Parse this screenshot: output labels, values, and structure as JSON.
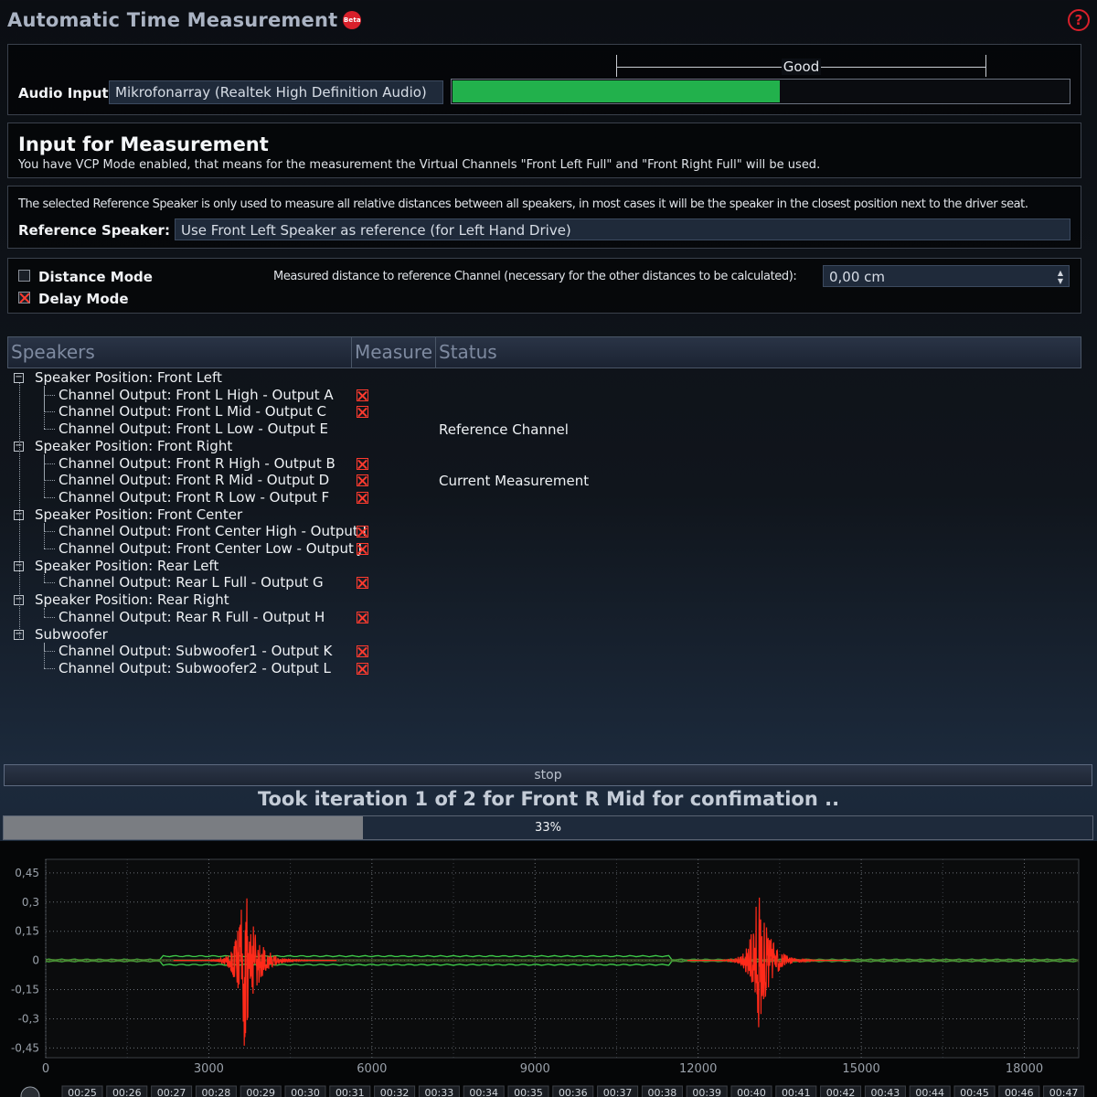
{
  "header": {
    "title": "Automatic Time Measurement",
    "beta_badge": "Beta",
    "help_icon": "?"
  },
  "audio_input": {
    "label": "Audio Input:",
    "device": "Mikrofonarray (Realtek High Definition Audio)",
    "level_label": "Good",
    "level_fraction": 0.53,
    "level_color": "#22b14c"
  },
  "measurement_input": {
    "title": "Input for Measurement",
    "description": "You have VCP Mode enabled, that means for the measurement the Virtual Channels \"Front Left Full\" and \"Front Right Full\" will be used."
  },
  "reference": {
    "note": "The selected Reference Speaker is only used to measure all relative distances between all speakers, in most cases it will be the speaker in the closest position next to the driver seat.",
    "label": "Reference Speaker:",
    "value": "Use Front Left Speaker as reference (for Left Hand Drive)"
  },
  "mode": {
    "distance_mode": {
      "label": "Distance Mode",
      "checked": false
    },
    "delay_mode": {
      "label": "Delay Mode",
      "checked": true
    },
    "distance_label": "Measured distance to reference Channel (necessary for the other distances to be calculated):",
    "distance_value": "0,00 cm"
  },
  "table": {
    "columns": [
      "Speakers",
      "Measure",
      "Status"
    ],
    "rows": [
      {
        "level": 0,
        "text": "Speaker Position: Front Left",
        "measure": false,
        "status": ""
      },
      {
        "level": 1,
        "text": "Channel Output: Front L High - Output A",
        "measure": true,
        "status": ""
      },
      {
        "level": 1,
        "text": "Channel Output: Front L Mid - Output C",
        "measure": true,
        "status": ""
      },
      {
        "level": 1,
        "text": "Channel Output: Front L Low - Output E",
        "measure": false,
        "status": "Reference Channel"
      },
      {
        "level": 0,
        "text": "Speaker Position: Front Right",
        "measure": false,
        "status": ""
      },
      {
        "level": 1,
        "text": "Channel Output: Front R High - Output B",
        "measure": true,
        "status": ""
      },
      {
        "level": 1,
        "text": "Channel Output: Front R Mid - Output D",
        "measure": true,
        "status": "Current Measurement"
      },
      {
        "level": 1,
        "text": "Channel Output: Front R Low - Output F",
        "measure": true,
        "status": ""
      },
      {
        "level": 0,
        "text": "Speaker Position: Front Center",
        "measure": false,
        "status": ""
      },
      {
        "level": 1,
        "text": "Channel Output: Front Center High - Output I",
        "measure": true,
        "status": ""
      },
      {
        "level": 1,
        "text": "Channel Output: Front Center Low - Output J",
        "measure": true,
        "status": ""
      },
      {
        "level": 0,
        "text": "Speaker Position: Rear Left",
        "measure": false,
        "status": ""
      },
      {
        "level": 1,
        "text": "Channel Output: Rear L Full - Output G",
        "measure": true,
        "status": ""
      },
      {
        "level": 0,
        "text": "Speaker Position: Rear Right",
        "measure": false,
        "status": ""
      },
      {
        "level": 1,
        "text": "Channel Output: Rear R Full - Output H",
        "measure": true,
        "status": ""
      },
      {
        "level": 0,
        "text": "Subwoofer",
        "measure": false,
        "status": ""
      },
      {
        "level": 1,
        "text": "Channel Output: Subwoofer1 - Output K",
        "measure": true,
        "status": ""
      },
      {
        "level": 1,
        "text": "Channel Output: Subwoofer2 - Output L",
        "measure": true,
        "status": ""
      }
    ]
  },
  "controls": {
    "stop_label": "stop",
    "iteration_text": "Took iteration 1 of 2 for Front R Mid for confimation ..",
    "progress_fraction": 0.33,
    "progress_label": "33%"
  },
  "chart_data": {
    "type": "line",
    "xlim": [
      0,
      19000
    ],
    "ylim": [
      -0.5,
      0.52
    ],
    "x_ticks": [
      0,
      3000,
      6000,
      9000,
      12000,
      15000,
      18000
    ],
    "x_tick_labels": [
      "0",
      "3000",
      "6000",
      "9000",
      "12000",
      "15000",
      "18000"
    ],
    "y_ticks": [
      0.45,
      0.3,
      0.15,
      0,
      -0.15,
      -0.3,
      -0.45
    ],
    "y_tick_labels": [
      "0,45",
      "0,3",
      "0,15",
      "0",
      "-0,15",
      "-0,3",
      "-0,45"
    ],
    "grid": true,
    "series": [
      {
        "color": "#ff2a1a",
        "bursts": [
          {
            "center": 3650,
            "amplitude": 0.45
          },
          {
            "center": 13100,
            "amplitude": 0.38
          }
        ]
      },
      {
        "color": "#3fcf4a",
        "shift_start": 2100,
        "shift_end": 11500,
        "offset": 0.022
      }
    ],
    "timeline_labels": [
      "00:25",
      "00:26",
      "00:27",
      "00:28",
      "00:29",
      "00:30",
      "00:31",
      "00:32",
      "00:33",
      "00:34",
      "00:35",
      "00:36",
      "00:37",
      "00:38",
      "00:39",
      "00:40",
      "00:41",
      "00:42",
      "00:43",
      "00:44",
      "00:45",
      "00:46",
      "00:47"
    ]
  }
}
